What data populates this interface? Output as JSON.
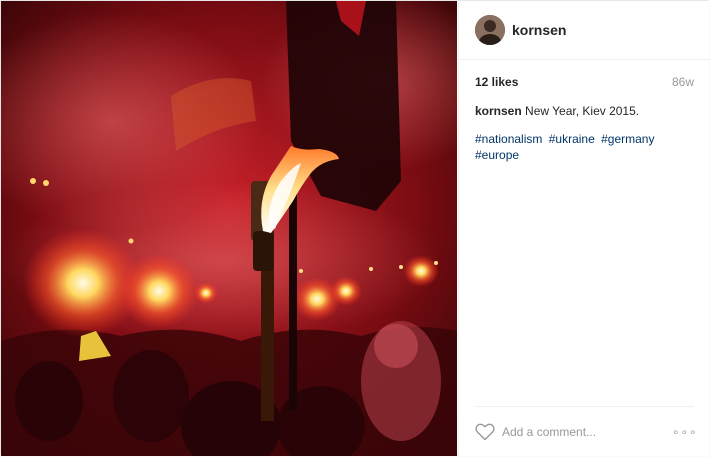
{
  "post": {
    "username": "kornsen",
    "likes": "12 likes",
    "age": "86w",
    "caption_user": "kornsen",
    "caption_text": " New Year, Kiev 2015.",
    "hashtags": [
      "#nationalism",
      "#ukraine",
      "#germany",
      "#europe"
    ]
  },
  "comment": {
    "placeholder": "Add a comment...",
    "more_label": "∘∘∘"
  },
  "icons": {
    "like": "heart-icon",
    "more": "more-options-icon",
    "avatar": "profile-avatar"
  },
  "colors": {
    "hashtag": "#003569",
    "username": "#262626",
    "muted": "#999999"
  }
}
